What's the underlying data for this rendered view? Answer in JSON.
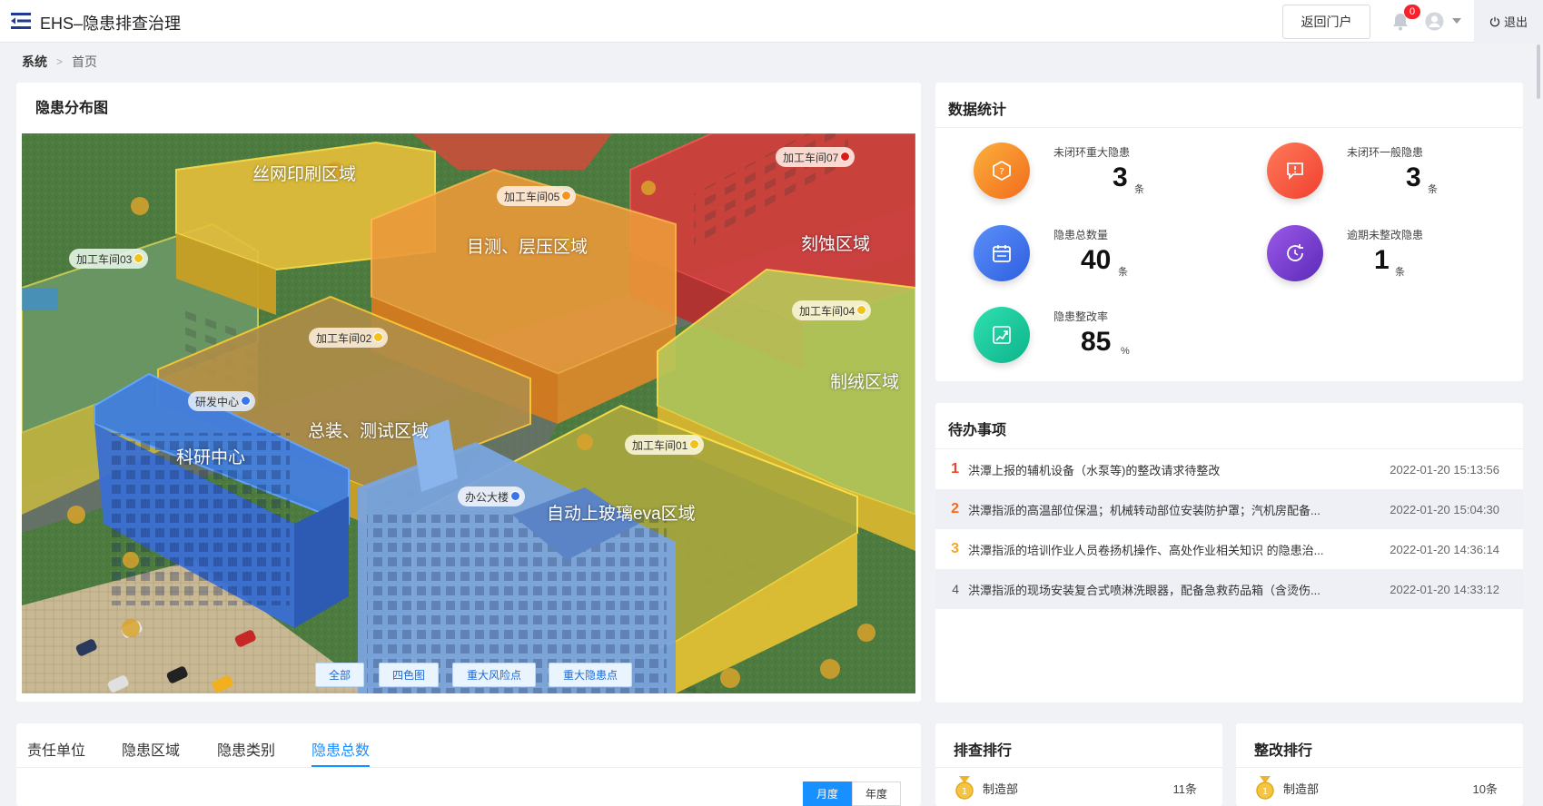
{
  "header": {
    "title": "EHS–隐患排查治理",
    "portal_label": "返回门户",
    "notification_count": "0",
    "logout_label": "退出"
  },
  "breadcrumb": [
    "系统",
    "首页"
  ],
  "map": {
    "title": "隐患分布图",
    "zones": [
      "丝网印刷区域",
      "目测、层压区域",
      "刻蚀区域",
      "制绒区域",
      "总装、测试区域",
      "科研中心",
      "自动上玻璃eva区域"
    ],
    "markers": [
      "加工车间07",
      "加工车间05",
      "加工车间03",
      "加工车间04",
      "加工车间02",
      "研发中心",
      "加工车间01",
      "办公大楼"
    ],
    "buttons": [
      "全部",
      "四色图",
      "重大风险点",
      "重大隐患点"
    ]
  },
  "stats": {
    "title": "数据统计",
    "items": [
      {
        "label": "未闭环重大隐患",
        "value": "3",
        "unit": "条"
      },
      {
        "label": "未闭环一般隐患",
        "value": "3",
        "unit": "条"
      },
      {
        "label": "隐患总数量",
        "value": "40",
        "unit": "条"
      },
      {
        "label": "逾期未整改隐患",
        "value": "1",
        "unit": "条"
      },
      {
        "label": "隐患整改率",
        "value": "85",
        "unit": "%"
      }
    ],
    "colors": {
      "orange": "#f7941d",
      "red": "#f5533d",
      "blue": "#3a75ea",
      "purple": "#7b3fd1",
      "green": "#19c99a"
    }
  },
  "todo": {
    "title": "待办事项",
    "rows": [
      {
        "idx": "1",
        "text": "洪潭上报的辅机设备（水泵等)的整改请求待整改",
        "time": "2022-01-20 15:13:56"
      },
      {
        "idx": "2",
        "text": "洪潭指派的高温部位保温；机械转动部位安装防护罩；汽机房配备...",
        "time": "2022-01-20 15:04:30"
      },
      {
        "idx": "3",
        "text": "洪潭指派的培训作业人员卷扬机操作、高处作业相关知识 的隐患治...",
        "time": "2022-01-20 14:36:14"
      },
      {
        "idx": "4",
        "text": "洪潭指派的现场安装复合式喷淋洗眼器，配备急救药品箱（含烫伤...",
        "time": "2022-01-20 14:33:12"
      }
    ]
  },
  "tabs": {
    "items": [
      "责任单位",
      "隐患区域",
      "隐患类别",
      "隐患总数"
    ],
    "active": 3,
    "toggle": [
      "月度",
      "年度"
    ]
  },
  "inspect_rank": {
    "title": "排查排行",
    "rows": [
      {
        "name": "制造部",
        "count": "11条"
      }
    ]
  },
  "rectify_rank": {
    "title": "整改排行",
    "rows": [
      {
        "name": "制造部",
        "count": "10条"
      }
    ]
  }
}
